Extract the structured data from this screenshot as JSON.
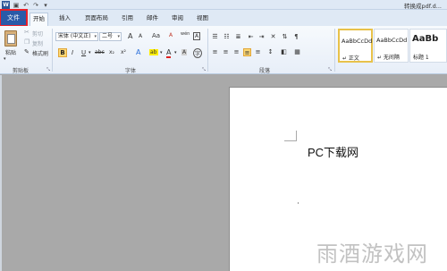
{
  "app": {
    "logo": "W",
    "title": "转换成pdf.d..."
  },
  "qat": {
    "save_icon": "save-icon",
    "undo_icon": "undo-icon",
    "redo_icon": "redo-icon"
  },
  "menu": {
    "file": "文件",
    "tabs": [
      "开始",
      "插入",
      "页面布局",
      "引用",
      "邮件",
      "审阅",
      "视图"
    ]
  },
  "ribbon": {
    "clipboard": {
      "paste": "粘贴",
      "cut": "剪切",
      "copy": "复制",
      "format_painter": "格式刷",
      "label": "剪贴板"
    },
    "font": {
      "font_name": "宋体 (中文正)",
      "font_size": "二号",
      "grow": "A",
      "shrink": "A",
      "change_case": "Aa",
      "clear_format": "A",
      "pinyin": "wén",
      "border_char": "A",
      "bold": "B",
      "italic": "I",
      "underline": "U",
      "strikethrough": "abc",
      "subscript": "x₂",
      "superscript": "x²",
      "text_effect": "A",
      "highlight": "ab",
      "font_color": "A",
      "shading": "A",
      "circle_char": "字",
      "label": "字体"
    },
    "paragraph": {
      "label": "段落"
    },
    "styles": {
      "items": [
        {
          "sample": "AaBbCcDd",
          "name": "↵ 正文"
        },
        {
          "sample": "AaBbCcDd",
          "name": "↵ 无间隔"
        },
        {
          "sample": "AaBb",
          "name": "标题 1"
        }
      ]
    }
  },
  "document": {
    "text": "PC下载网"
  },
  "watermark": "雨酒游戏网",
  "colors": {
    "file_tab": "#2a5aa8",
    "highlight_box": "#e8202a",
    "active_button": "#fbd773"
  }
}
